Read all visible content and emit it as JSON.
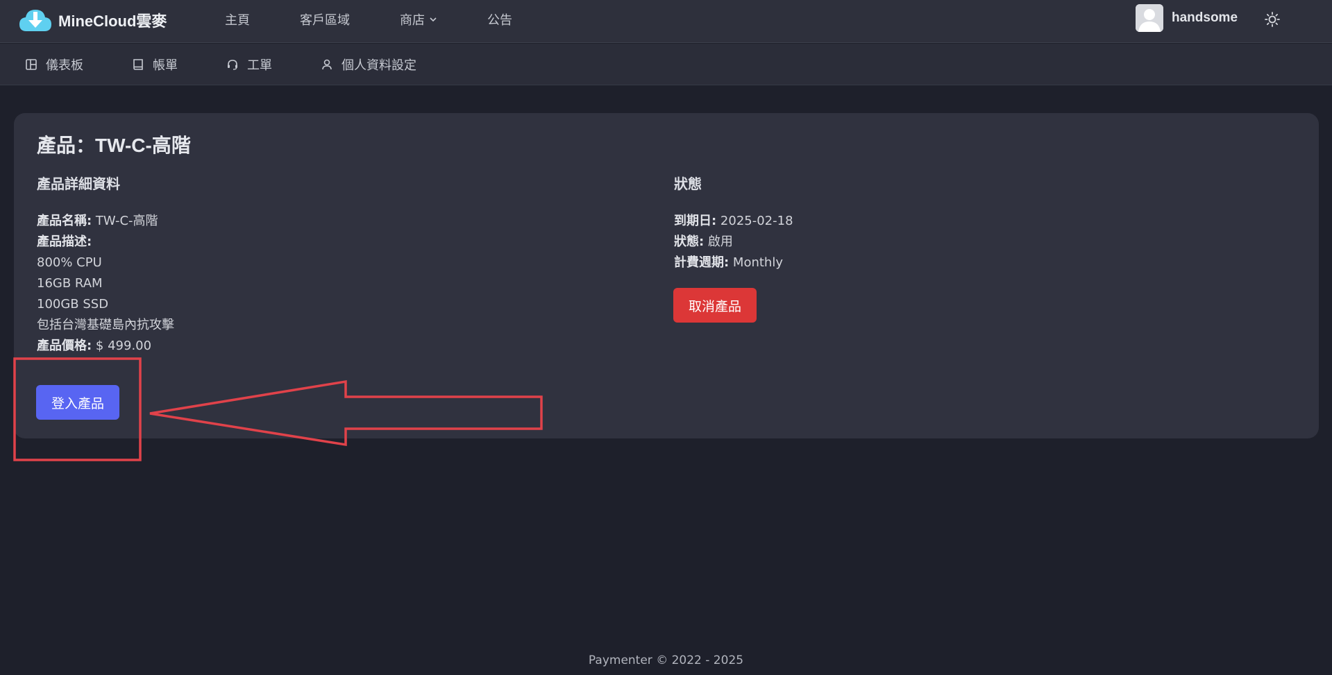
{
  "brand": {
    "name": "MineCloud雲麥",
    "logo_icon": "cloud-download-icon",
    "accent": "#5fd0f0"
  },
  "nav_main": [
    {
      "label": "主頁"
    },
    {
      "label": "客戶區域"
    },
    {
      "label": "商店",
      "has_dropdown": true
    },
    {
      "label": "公告"
    }
  ],
  "user": {
    "name": "handsome",
    "avatar_icon": "user-avatar-icon"
  },
  "theme_toggle_icon": "sun-icon",
  "nav_sub": [
    {
      "label": "儀表板",
      "icon": "dashboard-icon"
    },
    {
      "label": "帳單",
      "icon": "receipt-icon"
    },
    {
      "label": "工單",
      "icon": "headset-icon"
    },
    {
      "label": "個人資料設定",
      "icon": "user-icon"
    }
  ],
  "product": {
    "title": "產品：TW-C-高階",
    "details_heading": "產品詳細資料",
    "name_label": "產品名稱:",
    "name_value": " TW-C-高階",
    "desc_label": "產品描述:",
    "desc_lines": [
      "800% CPU",
      "16GB RAM",
      "100GB SSD",
      "包括台灣基礎島內抗攻擊"
    ],
    "price_label": "產品價格:",
    "price_value": " $ 499.00",
    "login_button": "登入產品"
  },
  "status": {
    "heading": "狀態",
    "due_label": "到期日:",
    "due_value": " 2025-02-18",
    "state_label": "狀態:",
    "state_value": " 啟用",
    "cycle_label": "計費週期:",
    "cycle_value": " Monthly",
    "cancel_button": "取消產品"
  },
  "colors": {
    "primary": "#5865f2",
    "danger": "#dc3737",
    "annotation": "#e0424a"
  },
  "footer": "Paymenter © 2022 - 2025"
}
